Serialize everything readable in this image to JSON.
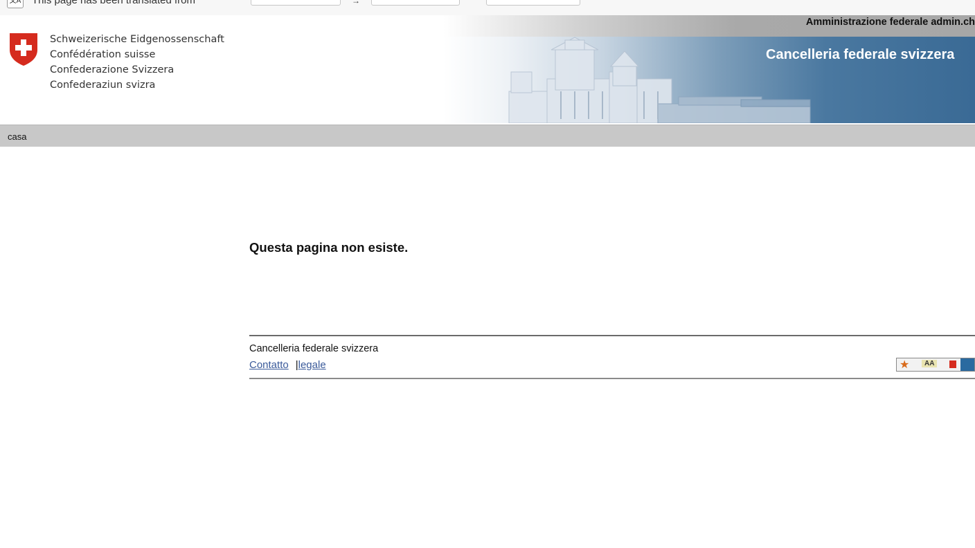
{
  "translate_bar": {
    "message": "This page has been translated from"
  },
  "header": {
    "confederation_names": [
      "Schweizerische Eidgenossenschaft",
      "Confédération suisse",
      "Confederazione Svizzera",
      "Confederaziun svizra"
    ],
    "admin_link": "Amministrazione federale admin.ch",
    "department_title": "Cancelleria federale svizzera"
  },
  "nav": {
    "home_label": "casa"
  },
  "main": {
    "message": "Questa pagina non esiste."
  },
  "footer": {
    "organization": "Cancelleria federale svizzera",
    "contact_link": "Contatto",
    "separator": "|",
    "legal_link": "legale",
    "badge_text": "AA"
  },
  "colors": {
    "nav_bar": "#c8c8c8",
    "banner_blue": "#3a6a95",
    "crest_red": "#d52b1e",
    "link_blue": "#3a5a9a"
  }
}
